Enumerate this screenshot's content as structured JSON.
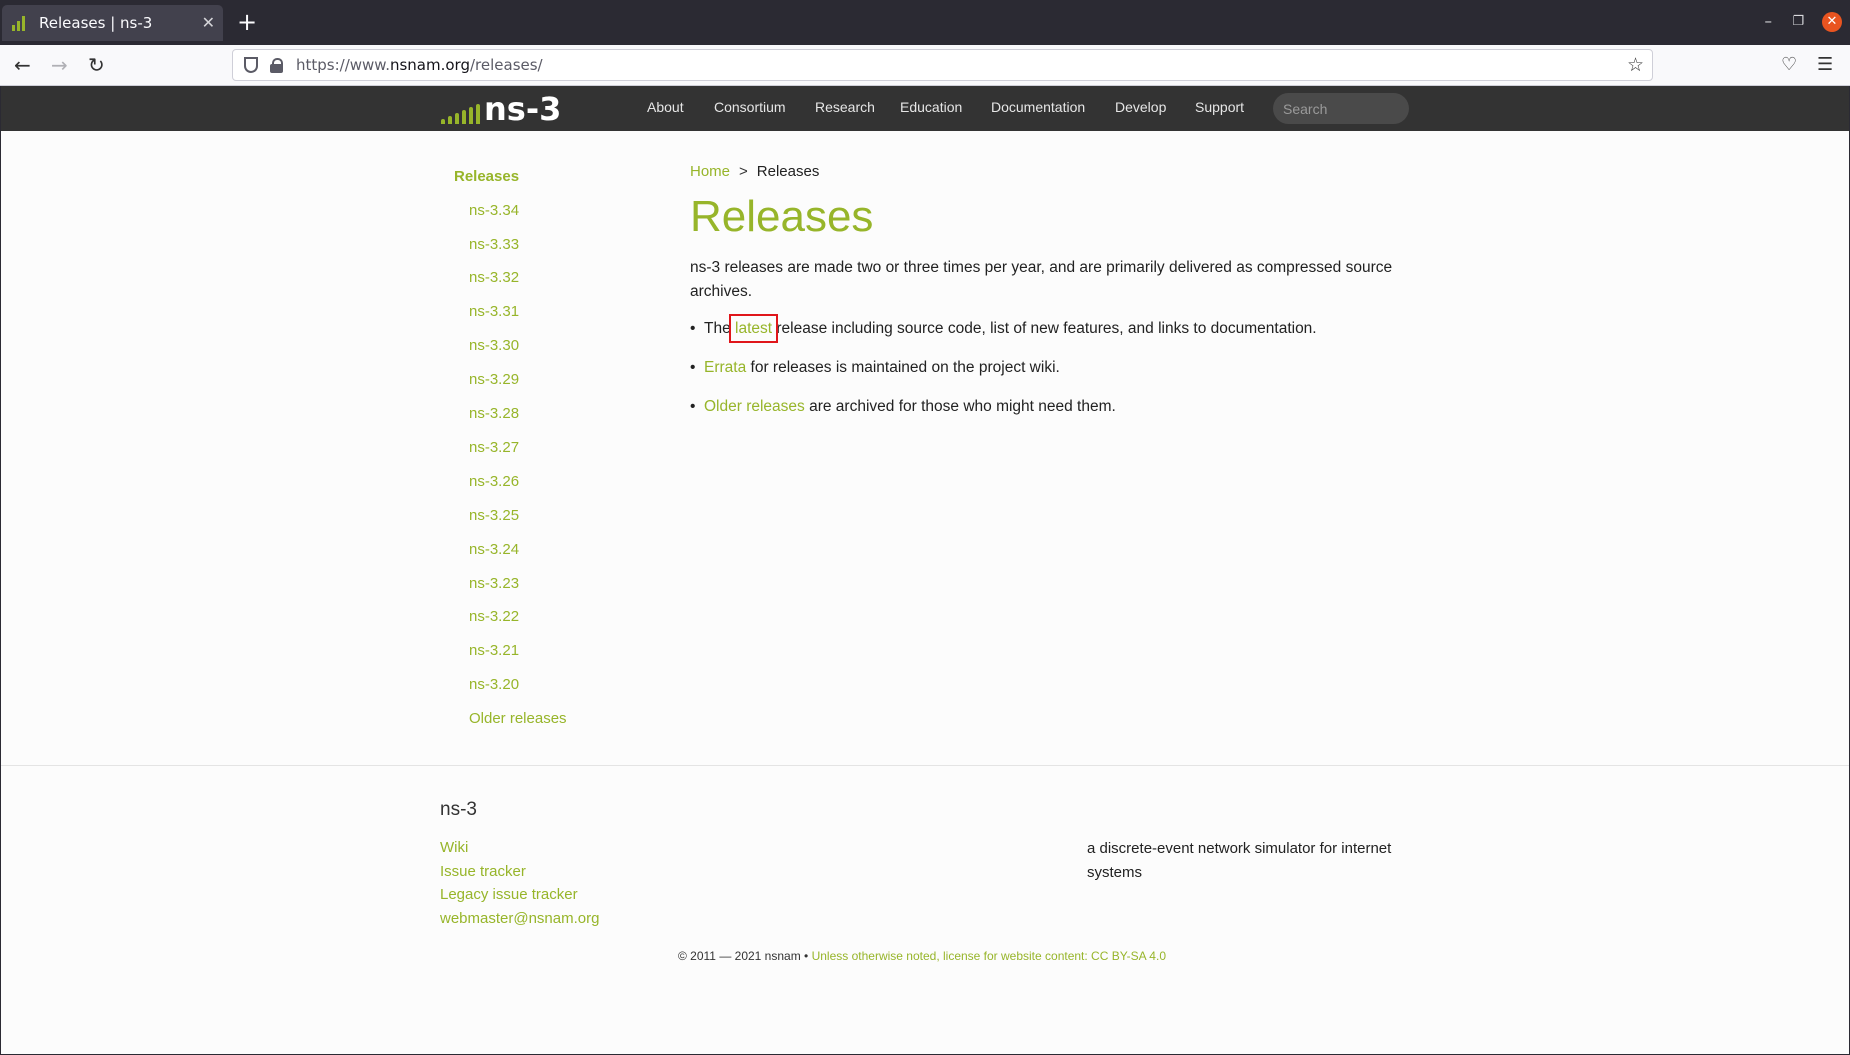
{
  "browser": {
    "tab_title": "Releases | ns-3",
    "url_prefix": "https://www.",
    "url_domain": "nsnam.org",
    "url_path": "/releases/"
  },
  "site": {
    "logo_text": "ns-3",
    "nav": [
      "About",
      "Consortium",
      "Research",
      "Education",
      "Documentation",
      "Develop",
      "Support"
    ],
    "search_placeholder": "Search"
  },
  "sidebar": {
    "heading": "Releases",
    "items": [
      "ns-3.34",
      "ns-3.33",
      "ns-3.32",
      "ns-3.31",
      "ns-3.30",
      "ns-3.29",
      "ns-3.28",
      "ns-3.27",
      "ns-3.26",
      "ns-3.25",
      "ns-3.24",
      "ns-3.23",
      "ns-3.22",
      "ns-3.21",
      "ns-3.20",
      "Older releases"
    ]
  },
  "main": {
    "breadcrumb_home": "Home",
    "breadcrumb_sep": ">",
    "breadcrumb_current": "Releases",
    "title": "Releases",
    "intro": "ns-3 releases are made two or three times per year, and are primarily delivered as compressed source archives.",
    "bullets": [
      {
        "pre": "The ",
        "link": "latest",
        "post": " release including source code, list of new features, and links to documentation."
      },
      {
        "pre": "",
        "link": "Errata",
        "post": " for releases is maintained on the project wiki."
      },
      {
        "pre": "",
        "link": "Older releases",
        "post": " are archived for those who might need them."
      }
    ]
  },
  "footer": {
    "brand": "ns-3",
    "links": [
      "Wiki",
      "Issue tracker",
      "Legacy issue tracker",
      "webmaster@nsnam.org"
    ],
    "tagline": "a discrete-event network simulator for internet systems",
    "copyright": "© 2011 — 2021 nsnam • ",
    "license": "Unless otherwise noted, license for website content: CC BY-SA 4.0"
  },
  "colors": {
    "accent": "#97b52a",
    "header_bg": "#333333",
    "highlight_box": "#e0161b"
  }
}
